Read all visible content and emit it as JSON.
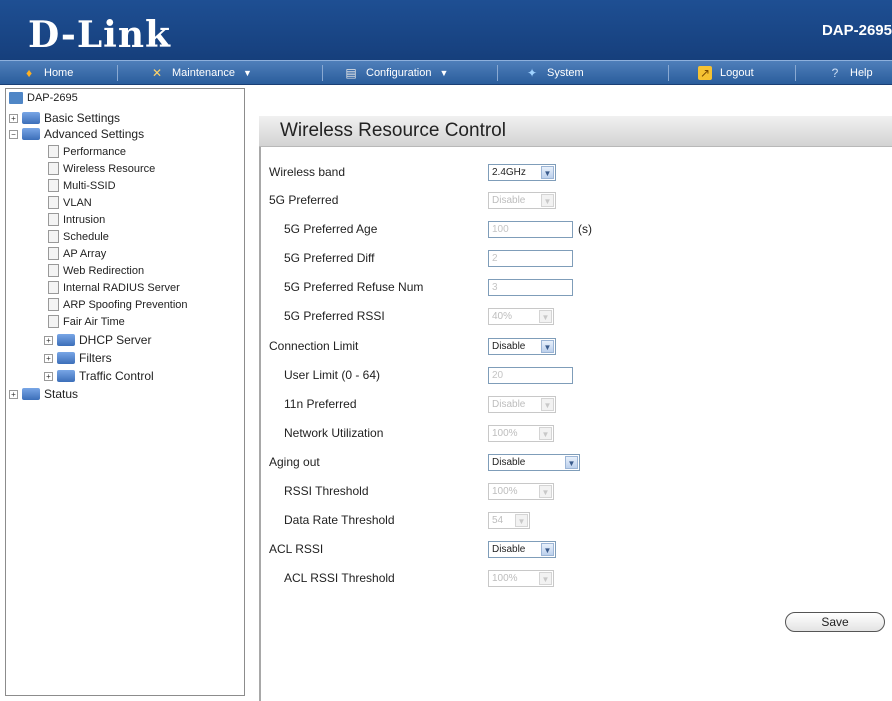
{
  "header": {
    "logo": "D-Link",
    "model": "DAP-2695"
  },
  "nav": {
    "home": "Home",
    "maintenance": "Maintenance",
    "configuration": "Configuration",
    "system": "System",
    "logout": "Logout",
    "help": "Help"
  },
  "tree": {
    "root": "DAP-2695",
    "basic_settings": "Basic Settings",
    "advanced_settings": "Advanced Settings",
    "items": [
      "Performance",
      "Wireless Resource",
      "Multi-SSID",
      "VLAN",
      "Intrusion",
      "Schedule",
      "AP Array",
      "Web Redirection",
      "Internal RADIUS Server",
      "ARP Spoofing Prevention",
      "Fair Air Time"
    ],
    "dhcp_server": "DHCP Server",
    "filters": "Filters",
    "traffic_control": "Traffic Control",
    "status": "Status"
  },
  "panel": {
    "title": "Wireless Resource Control",
    "rows": [
      {
        "label": "Wireless band",
        "value": "2.4GHz"
      },
      {
        "label": "5G Preferred",
        "value": "Disable"
      },
      {
        "label": "5G Preferred Age",
        "value": "100",
        "unit": "(s)"
      },
      {
        "label": "5G Preferred Diff",
        "value": "2"
      },
      {
        "label": "5G Preferred Refuse Num",
        "value": "3"
      },
      {
        "label": "5G Preferred RSSI",
        "value": "40%"
      },
      {
        "label": "Connection Limit",
        "value": "Disable"
      },
      {
        "label": "User Limit (0 - 64)",
        "value": "20"
      },
      {
        "label": "11n Preferred",
        "value": "Disable"
      },
      {
        "label": "Network Utilization",
        "value": "100%"
      },
      {
        "label": "Aging out",
        "value": "Disable"
      },
      {
        "label": "RSSI Threshold",
        "value": "100%"
      },
      {
        "label": "Data Rate Threshold",
        "value": "54"
      },
      {
        "label": "ACL RSSI",
        "value": "Disable"
      },
      {
        "label": "ACL RSSI Threshold",
        "value": "100%"
      }
    ],
    "save_label": "Save"
  }
}
